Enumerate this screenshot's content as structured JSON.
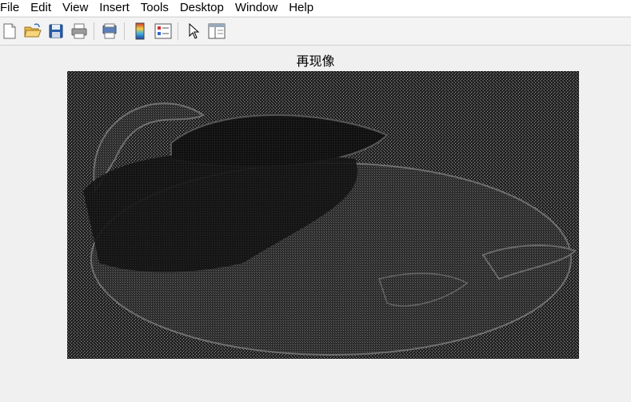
{
  "menubar": {
    "items": [
      "File",
      "Edit",
      "View",
      "Insert",
      "Tools",
      "Desktop",
      "Window",
      "Help"
    ]
  },
  "toolbar": {
    "buttons": [
      {
        "name": "new-figure-icon"
      },
      {
        "name": "open-file-icon"
      },
      {
        "name": "save-icon"
      },
      {
        "name": "print-icon"
      },
      {
        "name": "print-preview-icon"
      },
      {
        "name": "colorbar-icon"
      },
      {
        "name": "legend-icon"
      },
      {
        "name": "edit-plot-arrow-icon"
      },
      {
        "name": "property-inspector-icon"
      }
    ]
  },
  "figure": {
    "title": "再现像"
  }
}
